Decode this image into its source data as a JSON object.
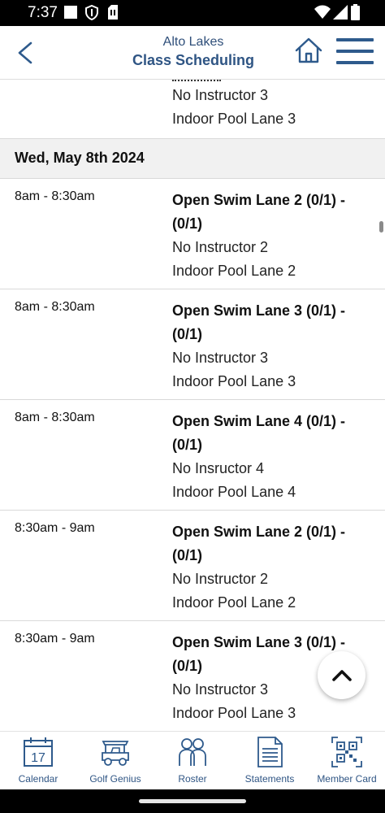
{
  "status_bar": {
    "time": "7:37"
  },
  "header": {
    "club_name": "Alto Lakes",
    "title": "Class Scheduling",
    "accent_color": "#2f5584"
  },
  "partial_entry": {
    "instructor": "No Instructor 3",
    "location": "Indoor Pool Lane 3"
  },
  "date_header": "Wed, May 8th 2024",
  "classes": [
    {
      "time": "8am - 8:30am",
      "name": "Open Swim Lane 2 (0/1) - (0/1)",
      "instructor": "No Instructor 2",
      "location": "Indoor Pool Lane 2"
    },
    {
      "time": "8am - 8:30am",
      "name": "Open Swim Lane 3 (0/1) - (0/1)",
      "instructor": "No Instructor 3",
      "location": "Indoor Pool Lane 3"
    },
    {
      "time": "8am - 8:30am",
      "name": "Open Swim Lane 4 (0/1) - (0/1)",
      "instructor": "No Insructor 4",
      "location": "Indoor Pool Lane 4"
    },
    {
      "time": "8:30am - 9am",
      "name": "Open Swim Lane 2 (0/1) - (0/1)",
      "instructor": "No Instructor 2",
      "location": "Indoor Pool Lane 2"
    },
    {
      "time": "8:30am - 9am",
      "name": "Open Swim Lane 3 (0/1) - (0/1)",
      "instructor": "No Instructor 3",
      "location": "Indoor Pool Lane 3"
    }
  ],
  "bottom_nav": [
    {
      "label": "Calendar",
      "icon": "calendar-icon",
      "calendar_day": "17"
    },
    {
      "label": "Golf Genius",
      "icon": "golf-cart-icon"
    },
    {
      "label": "Roster",
      "icon": "people-icon"
    },
    {
      "label": "Statements",
      "icon": "document-icon"
    },
    {
      "label": "Member Card",
      "icon": "qr-code-icon"
    }
  ]
}
